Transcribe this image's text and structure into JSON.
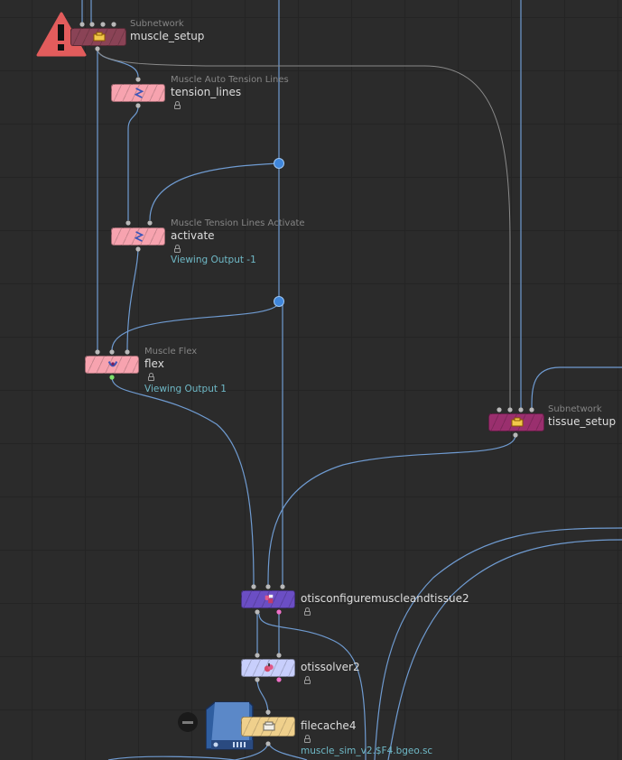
{
  "nodes": {
    "muscle_setup": {
      "type_label": "Subnetwork",
      "name": "muscle_setup",
      "color": "#8a4356"
    },
    "tension_lines": {
      "type_label": "Muscle Auto Tension Lines",
      "name": "tension_lines",
      "color": "#f7a3af"
    },
    "activate": {
      "type_label": "Muscle Tension Lines Activate",
      "name": "activate",
      "color": "#f7a3af",
      "viewing": "Viewing Output -1"
    },
    "flex": {
      "type_label": "Muscle Flex",
      "name": "flex",
      "color": "#f7a3af",
      "viewing": "Viewing Output 1"
    },
    "tissue_setup": {
      "type_label": "Subnetwork",
      "name": "tissue_setup",
      "color": "#9a2f6e"
    },
    "otisconfigure": {
      "name": "otisconfiguremuscleandtissue2",
      "color": "#6b4ec4"
    },
    "otissolver": {
      "name": "otissolver2",
      "color": "#c8cffc"
    },
    "filecache": {
      "name": "filecache4",
      "color": "#efd08c",
      "file": "muscle_sim_v2.$F4.bgeo.sc"
    }
  },
  "colors": {
    "wire": "#6f9bd1",
    "wire_gray": "#8a8a8a",
    "dot": "#3f86db",
    "background": "#2b2b2b"
  },
  "icons": [
    "warning-icon",
    "subnet-icon",
    "tension-lines-icon",
    "flex-icon",
    "otis-icon",
    "solver-icon",
    "filecache-icon",
    "bypass-icon",
    "disk-icon",
    "lock-icon"
  ]
}
